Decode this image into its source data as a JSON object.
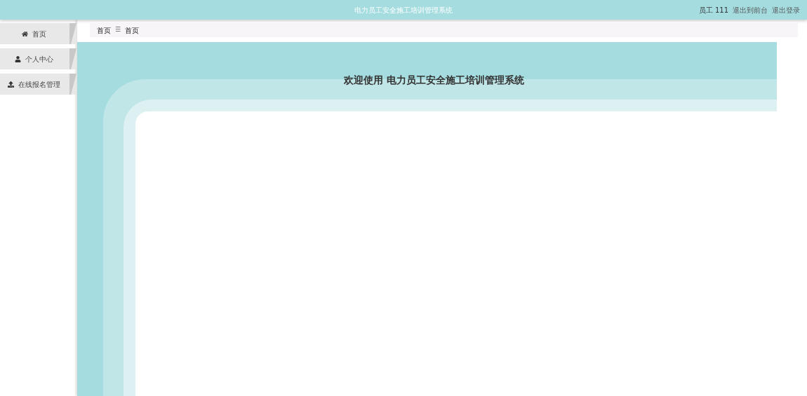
{
  "header": {
    "title": "电力员工安全施工培训管理系统",
    "user": "员工 111",
    "links": [
      "退出到前台",
      "退出登录"
    ]
  },
  "sidebar": {
    "items": [
      {
        "label": "首页"
      },
      {
        "label": "个人中心"
      },
      {
        "label": "在线报名管理"
      }
    ]
  },
  "breadcrumb": {
    "items": [
      "首页",
      "首页"
    ],
    "separator": "☰"
  },
  "welcome": {
    "title": "欢迎使用 电力员工安全施工培训管理系统"
  }
}
